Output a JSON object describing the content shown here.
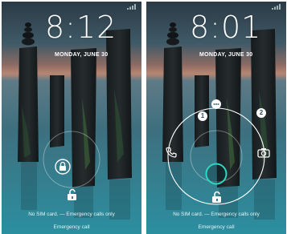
{
  "screens": [
    {
      "time": "8:12",
      "date": "MONDAY, JUNE 30",
      "no_sim_text": "No SIM card. — Emergency calls only",
      "emergency_call_label": "Emergency call"
    },
    {
      "time": "8:01",
      "date": "MONDAY, JUNE 30",
      "no_sim_text": "No SIM card. — Emergency calls only",
      "emergency_call_label": "Emergency call",
      "shortcut_badges": [
        "1",
        "2"
      ]
    }
  ],
  "icons": [
    "signal-icon",
    "lock-icon",
    "unlock-icon",
    "more-icon",
    "phone-icon",
    "camera-icon",
    "unlock-target-icon"
  ],
  "colors": {
    "ring": "#ffffff",
    "unlock_ring": "#2fd6c3",
    "text": "#ffffff"
  }
}
